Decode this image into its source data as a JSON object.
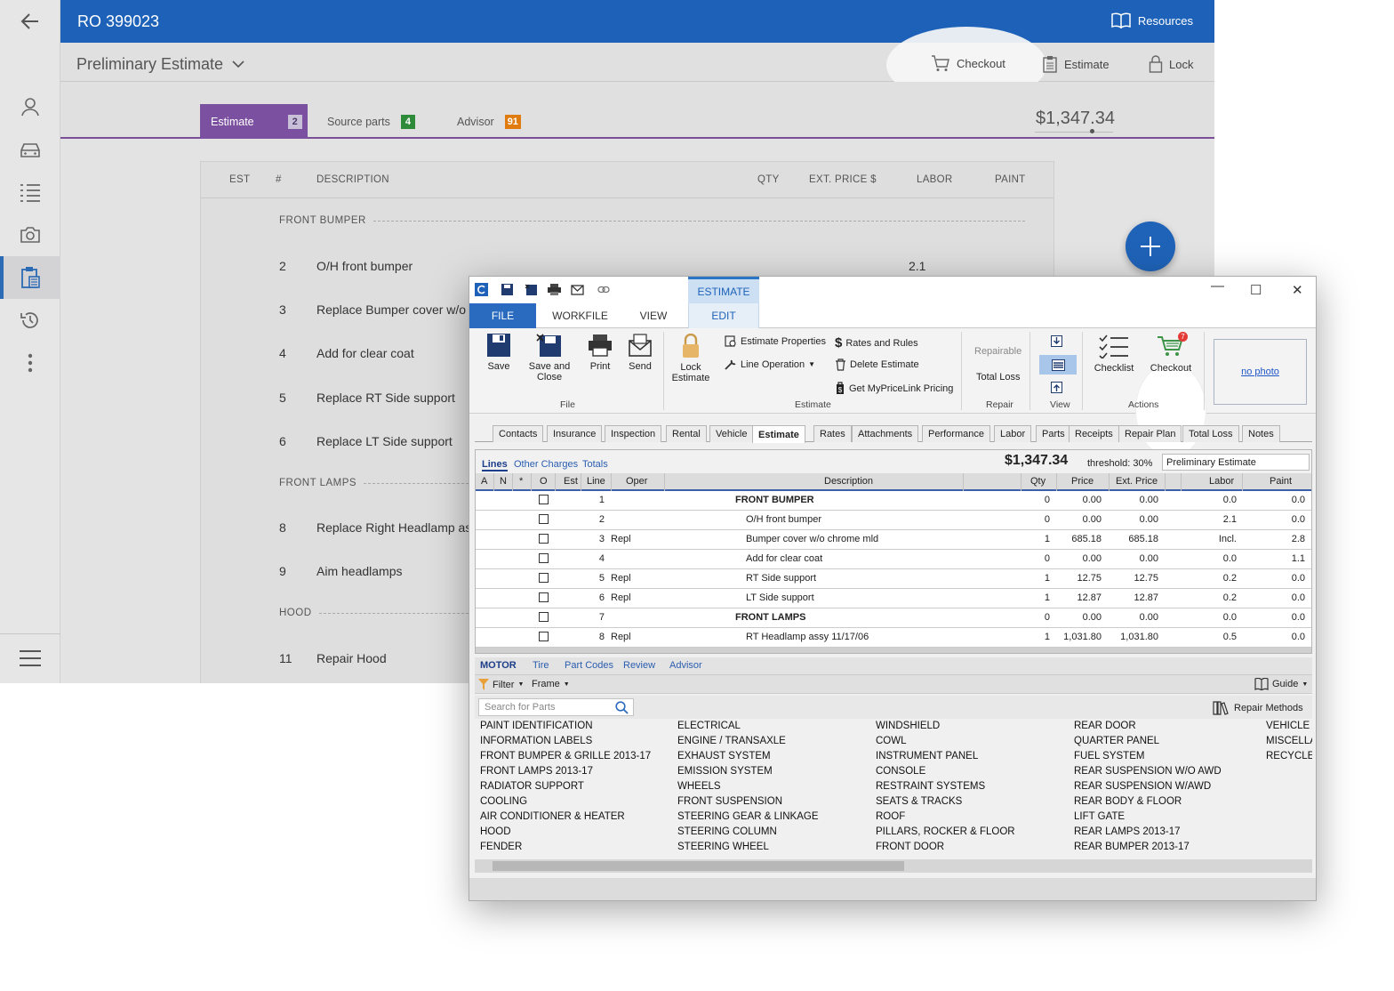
{
  "web": {
    "ro_title": "RO 399023",
    "resources_label": "Resources",
    "estimate_selector": "Preliminary Estimate",
    "actions": {
      "checkout": "Checkout",
      "estimate": "Estimate",
      "lock": "Lock"
    },
    "tabs": [
      {
        "label": "Estimate",
        "badge": "2",
        "badge_color": "#c8c0d8"
      },
      {
        "label": "Source parts",
        "badge": "4",
        "badge_color": "#2e8b3a"
      },
      {
        "label": "Advisor",
        "badge": "91",
        "badge_color": "#e07b10"
      }
    ],
    "total": "$1,347.34",
    "columns": [
      "EST",
      "#",
      "DESCRIPTION",
      "QTY",
      "EXT. PRICE $",
      "LABOR",
      "PAINT"
    ],
    "sections": [
      "FRONT BUMPER",
      "FRONT LAMPS",
      "HOOD"
    ],
    "lines": [
      {
        "num": "2",
        "desc": "O/H front bumper",
        "labor": "2.1"
      },
      {
        "num": "3",
        "desc": "Replace Bumper cover w/o"
      },
      {
        "num": "4",
        "desc": "Add for clear coat"
      },
      {
        "num": "5",
        "desc": "Replace RT Side support"
      },
      {
        "num": "6",
        "desc": "Replace LT Side support"
      },
      {
        "num": "8",
        "desc": "Replace Right Headlamp as"
      },
      {
        "num": "9",
        "desc": "Aim headlamps"
      },
      {
        "num": "11",
        "desc": "Repair Hood"
      }
    ]
  },
  "window": {
    "context_tab": "ESTIMATE",
    "ribbon_tabs": [
      "FILE",
      "WORKFILE",
      "VIEW",
      "EDIT"
    ],
    "file_group": {
      "save": "Save",
      "save_close": "Save and Close",
      "print": "Print",
      "send": "Send",
      "label": "File"
    },
    "lock": "Lock Estimate",
    "estimate_group": {
      "properties": "Estimate Properties",
      "line_operation": "Line Operation",
      "rates": "Rates and Rules",
      "delete": "Delete Estimate",
      "mypricelink": "Get MyPriceLink Pricing",
      "label": "Estimate"
    },
    "repair_group": {
      "repairable": "Repairable",
      "total_loss": "Total Loss",
      "label": "Repair"
    },
    "view_label": "View",
    "actions_group": {
      "checklist": "Checklist",
      "checkout": "Checkout",
      "checkout_badge": "7",
      "label": "Actions"
    },
    "no_photo": "no photo",
    "workfile_tabs": [
      "Contacts",
      "Insurance",
      "Inspection",
      "Rental",
      "Vehicle",
      "Estimate",
      "Rates",
      "Attachments",
      "Performance",
      "Labor",
      "Parts",
      "Receipts",
      "Repair Plan",
      "Total Loss",
      "Notes"
    ],
    "grid_tabs": [
      "Lines",
      "Other Charges",
      "Totals"
    ],
    "grid_total": "$1,347.34",
    "threshold": "threshold: 30%",
    "status": "Preliminary Estimate",
    "grid_columns": [
      "A",
      "N",
      "*",
      "O",
      "Est",
      "Line",
      "Oper",
      "Description",
      "Qty",
      "Price",
      "Ext. Price",
      "Labor",
      "Paint"
    ],
    "grid_rows": [
      {
        "line": "1",
        "oper": "",
        "desc": "FRONT BUMPER",
        "header": true,
        "qty": "0",
        "price": "0.00",
        "ext": "0.00",
        "labor": "0.0",
        "paint": "0.0"
      },
      {
        "line": "2",
        "oper": "",
        "desc": "O/H front bumper",
        "qty": "0",
        "price": "0.00",
        "ext": "0.00",
        "labor": "2.1",
        "paint": "0.0"
      },
      {
        "line": "3",
        "oper": "Repl",
        "desc": "Bumper cover w/o chrome mld",
        "qty": "1",
        "price": "685.18",
        "ext": "685.18",
        "labor": "Incl.",
        "paint": "2.8"
      },
      {
        "line": "4",
        "oper": "",
        "desc": "Add for clear coat",
        "qty": "0",
        "price": "0.00",
        "ext": "0.00",
        "labor": "0.0",
        "paint": "1.1"
      },
      {
        "line": "5",
        "oper": "Repl",
        "desc": "RT Side support",
        "qty": "1",
        "price": "12.75",
        "ext": "12.75",
        "labor": "0.2",
        "paint": "0.0"
      },
      {
        "line": "6",
        "oper": "Repl",
        "desc": "LT Side support",
        "qty": "1",
        "price": "12.87",
        "ext": "12.87",
        "labor": "0.2",
        "paint": "0.0"
      },
      {
        "line": "7",
        "oper": "",
        "desc": "FRONT LAMPS",
        "header": true,
        "qty": "0",
        "price": "0.00",
        "ext": "0.00",
        "labor": "0.0",
        "paint": "0.0"
      },
      {
        "line": "8",
        "oper": "Repl",
        "desc": "RT Headlamp assy 11/17/06",
        "qty": "1",
        "price": "1,031.80",
        "ext": "1,031.80",
        "labor": "0.5",
        "paint": "0.0"
      }
    ],
    "motor_tabs": [
      "MOTOR",
      "Tire",
      "Part Codes",
      "Review",
      "Advisor"
    ],
    "filter": "Filter",
    "frame": "Frame",
    "guide": "Guide",
    "search_placeholder": "Search for Parts",
    "repair_methods": "Repair Methods",
    "categories": [
      [
        "PAINT IDENTIFICATION",
        "INFORMATION LABELS",
        "FRONT BUMPER & GRILLE 2013-17",
        "FRONT LAMPS 2013-17",
        "RADIATOR SUPPORT",
        "COOLING",
        "AIR CONDITIONER & HEATER",
        "HOOD",
        "FENDER"
      ],
      [
        "ELECTRICAL",
        "ENGINE / TRANSAXLE",
        "EXHAUST SYSTEM",
        "EMISSION SYSTEM",
        "WHEELS",
        "FRONT SUSPENSION",
        "STEERING GEAR & LINKAGE",
        "STEERING COLUMN",
        "STEERING WHEEL"
      ],
      [
        "WINDSHIELD",
        "COWL",
        "INSTRUMENT PANEL",
        "CONSOLE",
        "RESTRAINT SYSTEMS",
        "SEATS & TRACKS",
        "ROOF",
        "PILLARS, ROCKER & FLOOR",
        "FRONT DOOR"
      ],
      [
        "REAR DOOR",
        "QUARTER PANEL",
        "FUEL SYSTEM",
        "REAR SUSPENSION W/O AWD",
        "REAR SUSPENSION W/AWD",
        "REAR BODY & FLOOR",
        "LIFT GATE",
        "REAR LAMPS 2013-17",
        "REAR BUMPER 2013-17"
      ],
      [
        "VEHICLE",
        "MISCELLA",
        "RECYCLE"
      ]
    ]
  }
}
